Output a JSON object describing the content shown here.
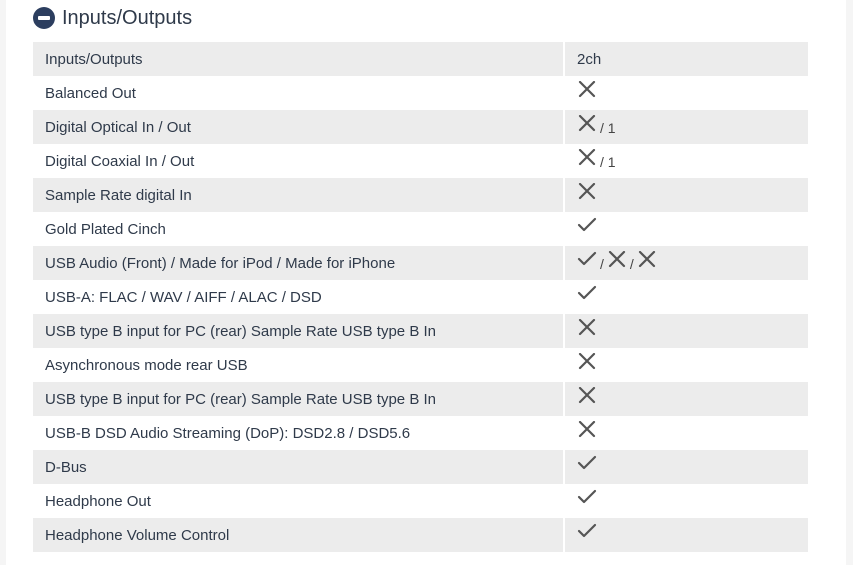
{
  "section": {
    "title": "Inputs/Outputs",
    "icon": "minus-circle-icon"
  },
  "colors": {
    "header_icon": "#2c3e5f",
    "row_shade": "#ececec",
    "text": "#2f3a4a",
    "symbol": "#555555"
  },
  "rows": [
    {
      "label": "Inputs/Outputs",
      "value": [
        {
          "t": "text",
          "v": "2ch"
        }
      ]
    },
    {
      "label": "Balanced Out",
      "value": [
        {
          "t": "cross"
        }
      ]
    },
    {
      "label": "Digital Optical In / Out",
      "value": [
        {
          "t": "cross"
        },
        {
          "t": "sep",
          "v": "/ 1"
        }
      ]
    },
    {
      "label": "Digital Coaxial In / Out",
      "value": [
        {
          "t": "cross"
        },
        {
          "t": "sep",
          "v": "/ 1"
        }
      ]
    },
    {
      "label": "Sample Rate digital In",
      "value": [
        {
          "t": "cross"
        }
      ]
    },
    {
      "label": "Gold Plated Cinch",
      "value": [
        {
          "t": "check"
        }
      ]
    },
    {
      "label": "USB Audio (Front) / Made for iPod / Made for iPhone",
      "value": [
        {
          "t": "check"
        },
        {
          "t": "sep",
          "v": "/"
        },
        {
          "t": "cross"
        },
        {
          "t": "sep",
          "v": "/"
        },
        {
          "t": "cross"
        }
      ]
    },
    {
      "label": "USB-A: FLAC / WAV / AIFF / ALAC / DSD",
      "value": [
        {
          "t": "check"
        }
      ]
    },
    {
      "label": "USB type B input for PC (rear) Sample Rate USB type B In",
      "value": [
        {
          "t": "cross"
        }
      ]
    },
    {
      "label": "Asynchronous mode rear USB",
      "value": [
        {
          "t": "cross"
        }
      ]
    },
    {
      "label": "USB type B input for PC (rear) Sample Rate USB type B In",
      "value": [
        {
          "t": "cross"
        }
      ]
    },
    {
      "label": "USB-B DSD Audio Streaming (DoP): DSD2.8 / DSD5.6",
      "value": [
        {
          "t": "cross"
        }
      ]
    },
    {
      "label": "D-Bus",
      "value": [
        {
          "t": "check"
        }
      ]
    },
    {
      "label": "Headphone Out",
      "value": [
        {
          "t": "check"
        }
      ]
    },
    {
      "label": "Headphone Volume Control",
      "value": [
        {
          "t": "check"
        }
      ]
    }
  ]
}
